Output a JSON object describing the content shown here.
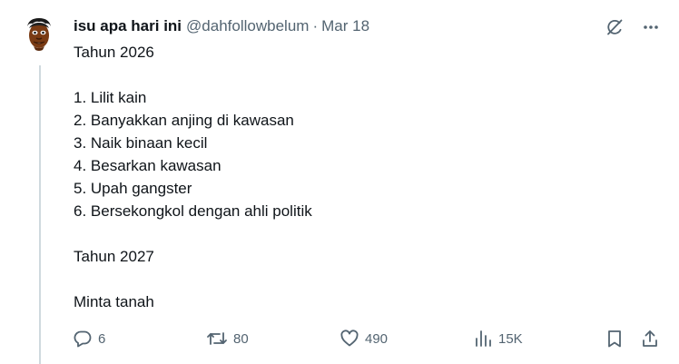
{
  "post": {
    "display_name": "isu apa hari ini",
    "handle": "@dahfollowbelum",
    "separator": "·",
    "date": "Mar 18",
    "avatar_icon": "avatar-face-icon",
    "lines": [
      "Tahun 2026",
      "",
      "1. Lilit kain",
      "2. Banyakkan anjing di kawasan",
      "3. Naik binaan kecil",
      "4. Besarkan kawasan",
      "5. Upah gangster",
      "6. Bersekongkol dengan ahli politik",
      "",
      "Tahun 2027",
      "",
      "Minta tanah"
    ]
  },
  "header_icons": [
    "grok-icon",
    "more-icon"
  ],
  "stats": {
    "replies": "6",
    "reposts": "80",
    "likes": "490",
    "views": "15K"
  },
  "action_icons": [
    "reply-icon",
    "repost-icon",
    "like-icon",
    "views-icon",
    "bookmark-icon",
    "share-icon"
  ],
  "colors": {
    "text": "#0f1419",
    "secondary": "#536471",
    "thread_line": "#cfd9de"
  }
}
